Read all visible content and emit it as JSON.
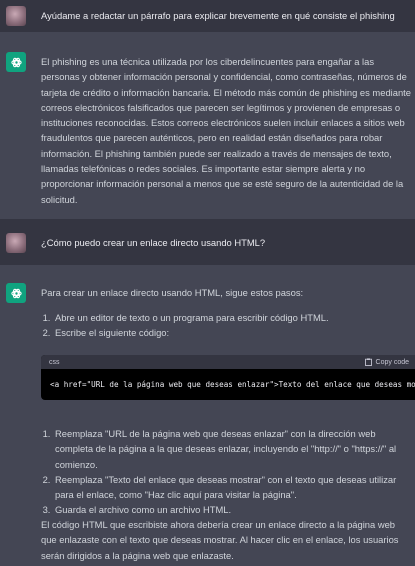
{
  "conversation": {
    "q1": "Ayúdame a redactar un párrafo para explicar brevemente en qué consiste el phishing",
    "a1": "El phishing es una técnica utilizada por los ciberdelincuentes para engañar a las personas y obtener información personal y confidencial, como contraseñas, números de tarjeta de crédito o información bancaria. El método más común de phishing es mediante correos electrónicos falsificados que parecen ser legítimos y provienen de empresas o instituciones reconocidas. Estos correos electrónicos suelen incluir enlaces a sitios web fraudulentos que parecen auténticos, pero en realidad están diseñados para robar información. El phishing también puede ser realizado a través de mensajes de texto, llamadas telefónicas o redes sociales. Es importante estar siempre alerta y no proporcionar información personal a menos que se esté seguro de la autenticidad de la solicitud.",
    "q2": "¿Cómo puedo crear un enlace directo usando HTML?",
    "a2": {
      "intro": "Para crear un enlace directo usando HTML, sigue estos pasos:",
      "steps_a": [
        "Abre un editor de texto o un programa para escribir código HTML.",
        "Escribe el siguiente código:"
      ],
      "code": {
        "lang": "css",
        "copy_label": "Copy code",
        "line": "<a href=\"URL de la página web que deseas enlazar\">Texto del enlace que deseas mostrar</a>"
      },
      "steps_b": [
        "Reemplaza \"URL de la página web que deseas enlazar\" con la dirección web completa de la página a la que deseas enlazar, incluyendo el \"http://\" o \"https://\" al comienzo.",
        "Reemplaza \"Texto del enlace que deseas mostrar\" con el texto que deseas utilizar para el enlace, como \"Haz clic aquí para visitar la página\".",
        "Guarda el archivo como un archivo HTML."
      ],
      "outro": "El código HTML que escribiste ahora debería crear un enlace directo a la página web que enlazaste con el texto que deseas mostrar. Al hacer clic en el enlace, los usuarios serán dirigidos a la página web que enlazaste."
    }
  },
  "colors": {
    "user_bg": "#343541",
    "bot_bg": "#444654",
    "gpt_green": "#10a37f"
  },
  "icons": {
    "user": "user-avatar",
    "gpt": "openai-logo-icon",
    "copy": "clipboard-icon"
  }
}
